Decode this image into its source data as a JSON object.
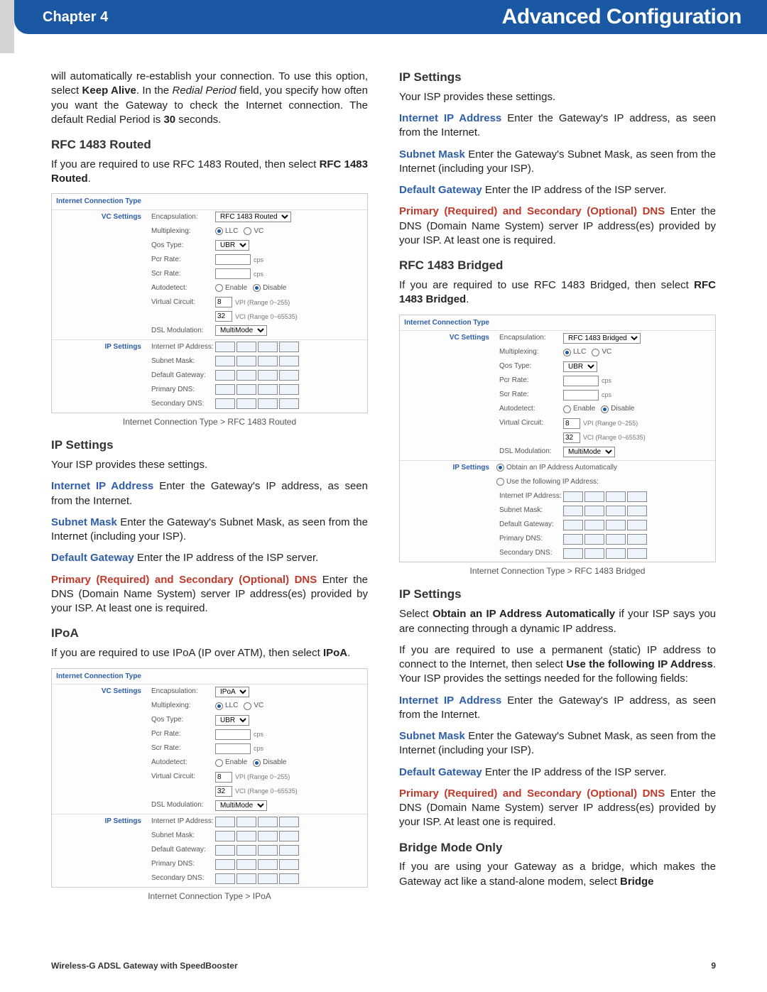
{
  "header": {
    "chapter": "Chapter 4",
    "title": "Advanced Configuration"
  },
  "footer": {
    "product": "Wireless-G ADSL Gateway with SpeedBooster",
    "page": "9"
  },
  "left": {
    "intro": "will automatically re-establish your connection. To use this option, select ",
    "intro_bold1": "Keep Alive",
    "intro_mid": ". In the ",
    "intro_ital": "Redial Period",
    "intro_tail": " field, you specify how often you want the Gateway to check the Internet connection. The default Redial Period is ",
    "intro_bold2": "30",
    "intro_end": " seconds.",
    "rfc_routed_h": "RFC 1483 Routed",
    "rfc_routed_p1": "If you are required to use RFC 1483 Routed, then select ",
    "rfc_routed_b": "RFC 1483 Routed",
    "caption1": "Internet Connection Type > RFC 1483 Routed",
    "ip_h": "IP Settings",
    "ip_intro": "Your ISP provides these settings.",
    "iip_term": "Internet IP Address",
    "iip_txt": "  Enter the Gateway's IP address, as seen from the Internet.",
    "sm_term": "Subnet Mask",
    "sm_txt": "  Enter the Gateway's Subnet Mask, as seen from the Internet (including your ISP).",
    "dg_term": "Default Gateway",
    "dg_txt": "  Enter the IP address of the ISP server.",
    "dns_term": "Primary (Required) and Secondary (Optional) DNS",
    "dns_txt": "  Enter the DNS (Domain Name System) server IP address(es) provided by your ISP. At least one is required.",
    "ipoa_h": "IPoA",
    "ipoa_p1": "If you are required to use IPoA (IP over ATM), then select ",
    "ipoa_b": "IPoA",
    "caption2": "Internet Connection Type > IPoA"
  },
  "right": {
    "ip_h": "IP Settings",
    "ip_intro": "Your ISP provides these settings.",
    "iip_term": "Internet IP Address",
    "iip_txt": "  Enter the Gateway's IP address, as seen from the Internet.",
    "sm_term": "Subnet Mask",
    "sm_txt": "  Enter the Gateway's Subnet Mask, as seen from the Internet (including your ISP).",
    "dg_term": "Default Gateway",
    "dg_txt": "  Enter the IP address of the ISP server.",
    "dns_term": "Primary (Required) and Secondary (Optional) DNS",
    "dns_txt": "  Enter the DNS (Domain Name System) server IP address(es) provided by your ISP. At least one is required.",
    "bridged_h": "RFC 1483 Bridged",
    "bridged_p1": "If you are required to use RFC 1483 Bridged, then select ",
    "bridged_b": "RFC 1483 Bridged",
    "caption3": "Internet Connection Type > RFC 1483 Bridged",
    "ip_h2": "IP Settings",
    "auto_p1": "Select ",
    "auto_b": "Obtain an IP Address Automatically",
    "auto_p2": " if your ISP says you are connecting through a dynamic IP address.",
    "static_p1": "If you are required to use a permanent (static) IP address to connect to the Internet, then select ",
    "static_b": "Use the following IP Address",
    "static_p2": ". Your ISP provides the settings needed for the following fields:",
    "bmo_h": "Bridge Mode Only",
    "bmo_p1": "If you are using your Gateway as a bridge, which makes the Gateway act like a stand-alone modem, select ",
    "bmo_b": "Bridge"
  },
  "shot": {
    "ict": "Internet Connection Type",
    "vcs": "VC Settings",
    "ips": "IP Settings",
    "encap": "Encapsulation:",
    "mux": "Multiplexing:",
    "qos": "Qos Type:",
    "pcr": "Pcr Rate:",
    "scr": "Scr Rate:",
    "auto": "Autodetect:",
    "vc": "Virtual Circuit:",
    "dsl": "DSL Modulation:",
    "iip": "Internet IP Address:",
    "sm": "Subnet Mask:",
    "dg": "Default Gateway:",
    "pdns": "Primary DNS:",
    "sdns": "Secondary DNS:",
    "llc": "LLC",
    "vc_opt": "VC",
    "enable": "Enable",
    "disable": "Disable",
    "ubr": "UBR",
    "cps": "cps",
    "vpi_hint": "VPI (Range 0~255)",
    "vci_hint": "VCI (Range 0~65535)",
    "mm": "MultiMode",
    "routed_opt": "RFC 1483 Routed",
    "ipoa_opt": "IPoA",
    "bridged_opt": "RFC 1483 Bridged",
    "vpi": "8",
    "vci": "32",
    "obtain": "Obtain an IP Address Automatically",
    "usefollow": "Use the following IP Address:"
  }
}
